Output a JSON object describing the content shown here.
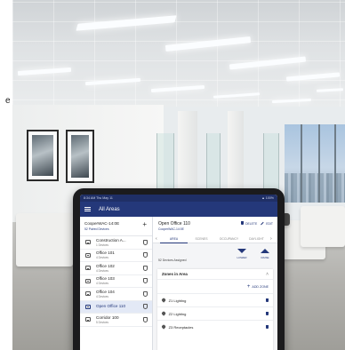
{
  "caption": {
    "fragment": "e"
  },
  "status": {
    "time": "8:34 AM   Thu May 11",
    "battery": "▲ 100%"
  },
  "app": {
    "title": "All Areas",
    "menu_icon": "menu-icon"
  },
  "device": {
    "name": "CooperWAC-14:0E",
    "panels": "52 Paired Devices",
    "add_icon": "plus-icon"
  },
  "areas": [
    {
      "name": "Construction A...",
      "sub": "1 Devices",
      "active": false
    },
    {
      "name": "Office 101",
      "sub": "4 Devices",
      "active": false
    },
    {
      "name": "Office 102",
      "sub": "4 Devices",
      "active": false
    },
    {
      "name": "Office 103",
      "sub": "4 Devices",
      "active": false
    },
    {
      "name": "Office 104",
      "sub": "4 Devices",
      "active": false
    },
    {
      "name": "Open Office 110",
      "sub": "",
      "active": true
    },
    {
      "name": "Corridor 100",
      "sub": "5 Devices",
      "active": false
    }
  ],
  "detail": {
    "title": "Open Office 110",
    "subtitle": "CooperWAC-14:0E",
    "delete_label": "DELETE",
    "edit_label": "EDIT",
    "tabs": [
      "AREA",
      "SCENES",
      "OCCUPANCY",
      "DAYLIGHT"
    ],
    "active_tab": 0,
    "assigned": "52 Devices Assigned",
    "lower_label": "LOWER",
    "raise_label": "RAISE"
  },
  "zones": {
    "title": "Zones in Area",
    "add_label": "ADD ZONE",
    "items": [
      "Z1 Lighting",
      "Z2 Lighting",
      "Z3 Receptacles"
    ]
  },
  "colors": {
    "brand": "#24387a",
    "status": "#1f2f66"
  }
}
